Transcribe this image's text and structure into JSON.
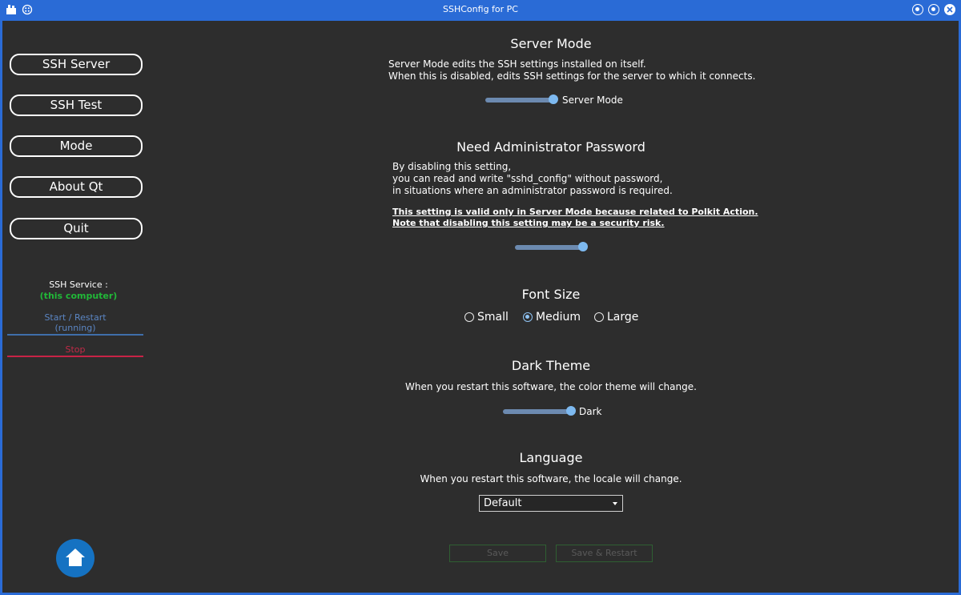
{
  "window": {
    "title": "SSHConfig for PC"
  },
  "sidebar": {
    "nav": [
      {
        "label": "SSH Server"
      },
      {
        "label": "SSH Test"
      },
      {
        "label": "Mode"
      },
      {
        "label": "About Qt"
      },
      {
        "label": "Quit"
      }
    ],
    "service_label": "SSH Service :",
    "service_target": "(this computer)",
    "start_label": "Start / Restart",
    "start_status": "(running)",
    "stop_label": "Stop"
  },
  "server_mode": {
    "title": "Server Mode",
    "desc_line1": "Server Mode edits the SSH settings installed on itself.",
    "desc_line2": "When this is disabled, edits SSH settings for the server to which it connects.",
    "toggle_label": "Server Mode",
    "enabled": true
  },
  "admin_password": {
    "title": "Need Administrator Password",
    "desc_line1": "By disabling this setting,",
    "desc_line2": "you can read and write \"sshd_config\" without password,",
    "desc_line3": "in situations where an administrator password is required.",
    "warn_line1": "This setting is valid only in Server Mode because related to Polkit Action.",
    "warn_line2": "Note that disabling this setting may be a security risk.",
    "enabled": true
  },
  "font_size": {
    "title": "Font Size",
    "options": [
      {
        "label": "Small",
        "selected": false
      },
      {
        "label": "Medium",
        "selected": true
      },
      {
        "label": "Large",
        "selected": false
      }
    ]
  },
  "dark_theme": {
    "title": "Dark Theme",
    "desc": "When you restart this software, the color theme will change.",
    "toggle_label": "Dark",
    "enabled": true
  },
  "language": {
    "title": "Language",
    "desc": "When you restart this software, the locale will change.",
    "selected": "Default"
  },
  "actions": {
    "save_label": "Save",
    "save_restart_label": "Save & Restart"
  },
  "colors": {
    "accent": "#2a6bd6",
    "background": "#2d2d2d",
    "running": "#21b838",
    "stop": "#c82346",
    "toggle_knob": "#7db9f0"
  }
}
